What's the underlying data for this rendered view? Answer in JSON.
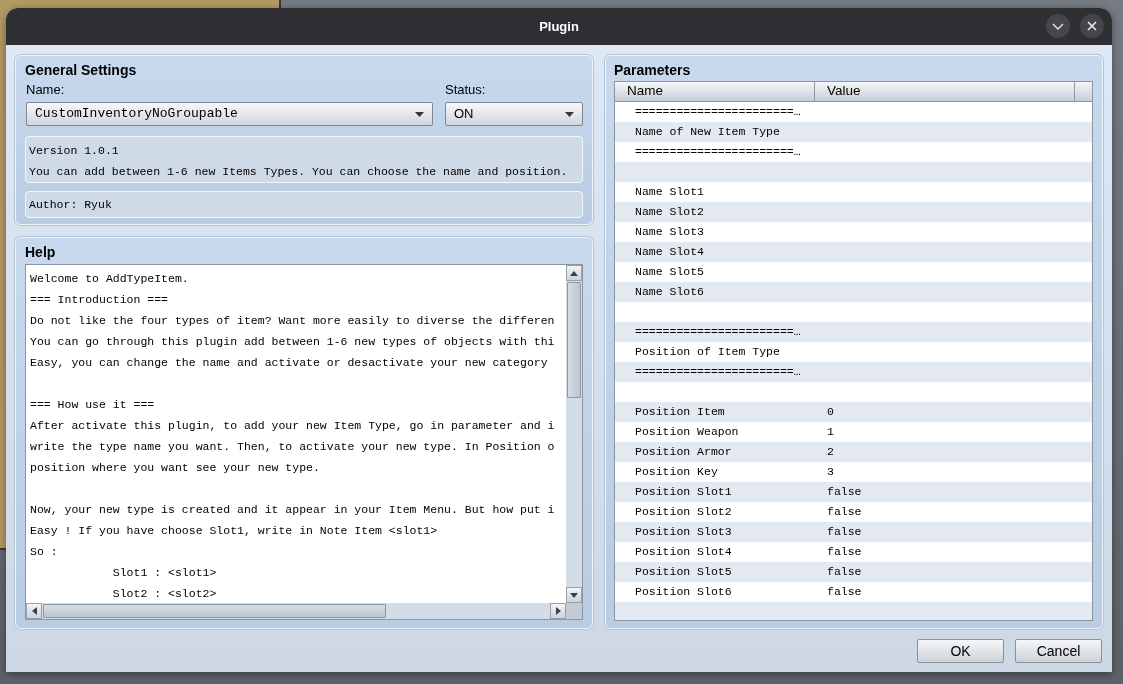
{
  "window": {
    "title": "Plugin"
  },
  "general_settings": {
    "title": "General Settings",
    "name_label": "Name:",
    "name_value": "CustomInventoryNoGroupable",
    "status_label": "Status:",
    "status_value": "ON",
    "version": "Version 1.0.1",
    "description": "You can add between 1-6 new Items Types. You can choose the name and position.",
    "author": "Author: Ryuk"
  },
  "help": {
    "title": "Help",
    "text": "Welcome to AddTypeItem.\n=== Introduction ===\nDo not like the four types of item? Want more easily to diverse the differen\nYou can go through this plugin add between 1-6 new types of objects with thi\nEasy, you can change the name and activate or desactivate your new category\n\n=== How use it ===\nAfter activate this plugin, to add your new Item Type, go in parameter and i\nwrite the type name you want. Then, to activate your new type. In Position o\nposition where you want see your new type.\n\nNow, your new type is created and it appear in your Item Menu. But how put i\nEasy ! If you have choose Slot1, write in Note Item <slot1>\nSo :\n            Slot1 : <slot1>\n            Slot2 : <slot2>"
  },
  "parameters": {
    "title": "Parameters",
    "columns": [
      "Name",
      "Value"
    ],
    "rows": [
      {
        "kind": "param",
        "name": "=======================…"
      },
      {
        "kind": "param",
        "name": "Name of New Item Type"
      },
      {
        "kind": "param",
        "name": "=======================…"
      },
      {
        "kind": "blank"
      },
      {
        "kind": "param",
        "name": "Name Slot1"
      },
      {
        "kind": "param",
        "name": "Name Slot2"
      },
      {
        "kind": "param",
        "name": "Name Slot3"
      },
      {
        "kind": "param",
        "name": "Name Slot4"
      },
      {
        "kind": "param",
        "name": "Name Slot5"
      },
      {
        "kind": "param",
        "name": "Name Slot6"
      },
      {
        "kind": "blank"
      },
      {
        "kind": "param",
        "name": "=======================…"
      },
      {
        "kind": "param",
        "name": "Position of Item Type"
      },
      {
        "kind": "param",
        "name": "=======================…"
      },
      {
        "kind": "blank"
      },
      {
        "kind": "param",
        "name": "Position Item",
        "value": "0"
      },
      {
        "kind": "param",
        "name": "Position Weapon",
        "value": "1"
      },
      {
        "kind": "param",
        "name": "Position Armor",
        "value": "2"
      },
      {
        "kind": "param",
        "name": "Position Key",
        "value": "3"
      },
      {
        "kind": "param",
        "name": "Position Slot1",
        "value": "false"
      },
      {
        "kind": "param",
        "name": "Position Slot2",
        "value": "false"
      },
      {
        "kind": "param",
        "name": "Position Slot3",
        "value": "false"
      },
      {
        "kind": "param",
        "name": "Position Slot4",
        "value": "false"
      },
      {
        "kind": "param",
        "name": "Position Slot5",
        "value": "false"
      },
      {
        "kind": "param",
        "name": "Position Slot6",
        "value": "false"
      },
      {
        "kind": "blank"
      }
    ]
  },
  "buttons": [
    "OK",
    "Cancel"
  ]
}
